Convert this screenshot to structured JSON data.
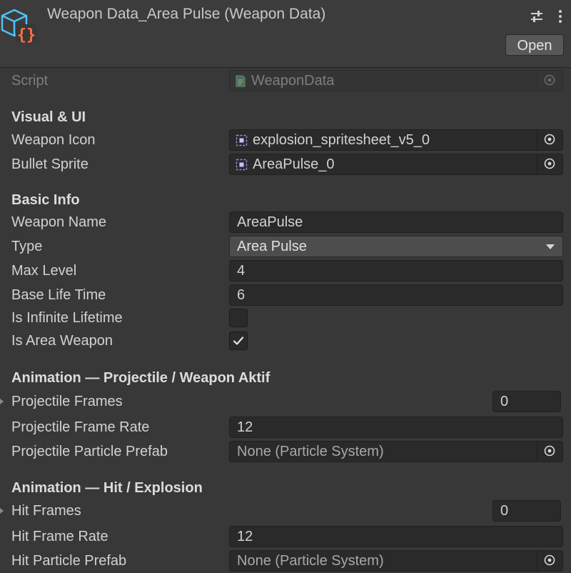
{
  "header": {
    "title": "Weapon Data_Area Pulse (Weapon Data)",
    "open_label": "Open",
    "asset_icon": "scriptable-object-cube-icon",
    "settings_icon": "sliders-icon",
    "menu_icon": "vertical-dots-icon"
  },
  "script": {
    "label": "Script",
    "value": "WeaponData"
  },
  "visual_ui": {
    "title": "Visual & UI",
    "weapon_icon": {
      "label": "Weapon Icon",
      "value": "explosion_spritesheet_v5_0"
    },
    "bullet_sprite": {
      "label": "Bullet Sprite",
      "value": "AreaPulse_0"
    }
  },
  "basic_info": {
    "title": "Basic Info",
    "weapon_name": {
      "label": "Weapon Name",
      "value": "AreaPulse"
    },
    "type": {
      "label": "Type",
      "value": "Area Pulse"
    },
    "max_level": {
      "label": "Max Level",
      "value": "4"
    },
    "base_life_time": {
      "label": "Base Life Time",
      "value": "6"
    },
    "is_infinite_lifetime": {
      "label": "Is Infinite Lifetime",
      "checked": false
    },
    "is_area_weapon": {
      "label": "Is Area Weapon",
      "checked": true
    }
  },
  "anim_projectile": {
    "title": "Animation — Projectile / Weapon Aktif",
    "frames": {
      "label": "Projectile Frames",
      "value": "0"
    },
    "frame_rate": {
      "label": "Projectile Frame Rate",
      "value": "12"
    },
    "particle_prefab": {
      "label": "Projectile Particle Prefab",
      "value": "None (Particle System)"
    }
  },
  "anim_hit": {
    "title": "Animation — Hit / Explosion",
    "frames": {
      "label": "Hit Frames",
      "value": "0"
    },
    "frame_rate": {
      "label": "Hit Frame Rate",
      "value": "12"
    },
    "particle_prefab": {
      "label": "Hit Particle Prefab",
      "value": "None (Particle System)"
    }
  },
  "colors": {
    "background": "#383838",
    "field": "#2a2a2a",
    "icon_cube": "#4fc3f7",
    "icon_braces": "#ff7043"
  }
}
